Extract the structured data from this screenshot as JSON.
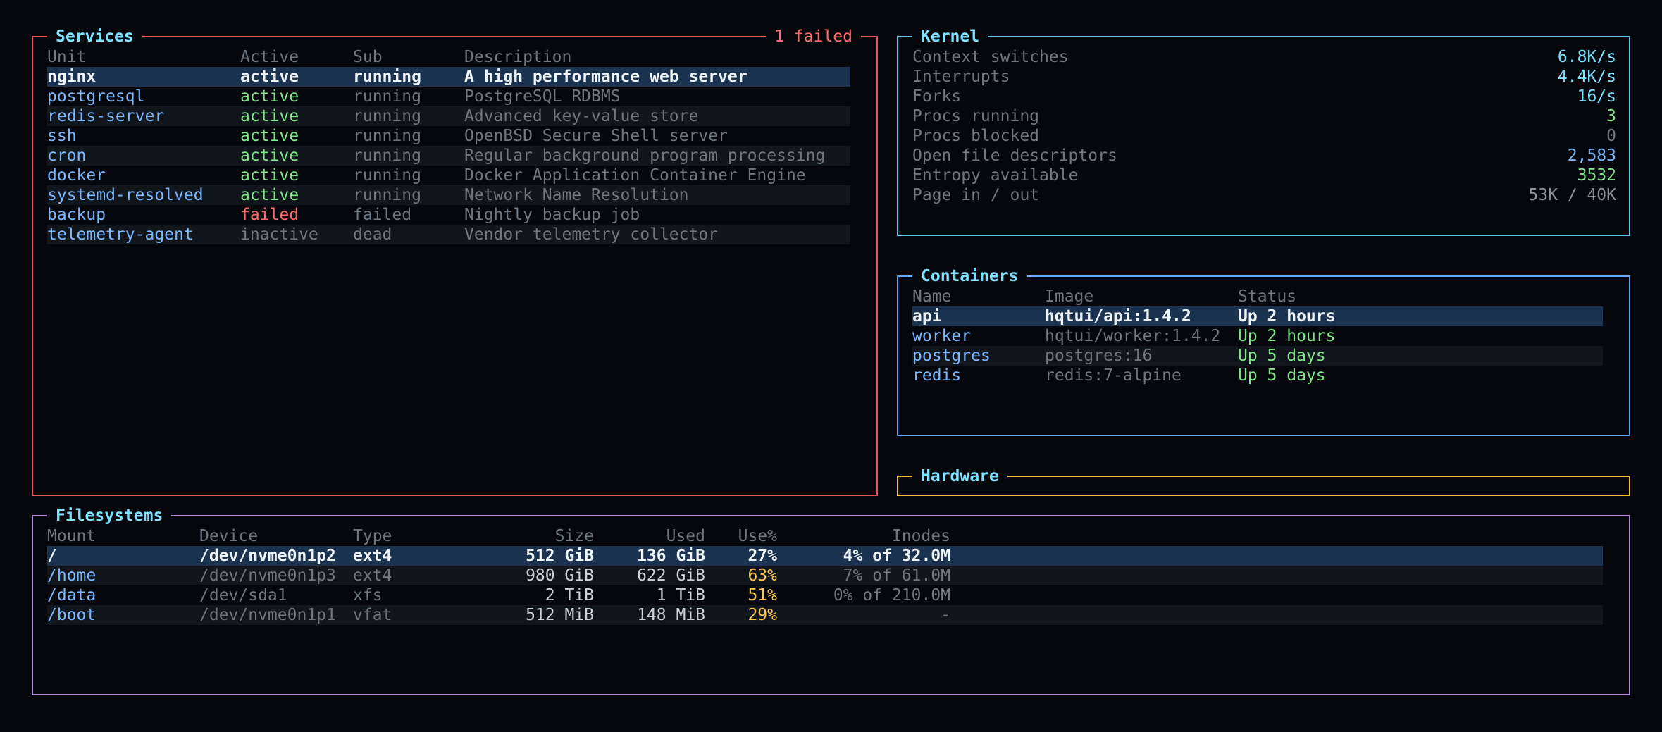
{
  "colors": {
    "background": "#05070c",
    "services_border": "#e8555a",
    "kernel_border": "#5ec8e6",
    "containers_border": "#5aa9ff",
    "hardware_border": "#f2c230",
    "filesystems_border": "#b48ce0",
    "selected_row": "#1b3350",
    "active_green": "#7ee787",
    "failed_red": "#ff6b6b",
    "name_blue": "#79b8ff",
    "usage_yellow": "#f9c74f",
    "title_cyan": "#7ee2ff"
  },
  "services": {
    "title": "Services",
    "badge": "1 failed",
    "columns": [
      "Unit",
      "Active",
      "Sub",
      "Description"
    ],
    "rows": [
      {
        "unit": "nginx",
        "active": "active",
        "sub": "running",
        "description": "A high performance web server",
        "state": "ok"
      },
      {
        "unit": "postgresql",
        "active": "active",
        "sub": "running",
        "description": "PostgreSQL RDBMS",
        "state": "ok"
      },
      {
        "unit": "redis-server",
        "active": "active",
        "sub": "running",
        "description": "Advanced key-value store",
        "state": "ok"
      },
      {
        "unit": "ssh",
        "active": "active",
        "sub": "running",
        "description": "OpenBSD Secure Shell server",
        "state": "ok"
      },
      {
        "unit": "cron",
        "active": "active",
        "sub": "running",
        "description": "Regular background program processing",
        "state": "ok"
      },
      {
        "unit": "docker",
        "active": "active",
        "sub": "running",
        "description": "Docker Application Container Engine",
        "state": "ok"
      },
      {
        "unit": "systemd-resolved",
        "active": "active",
        "sub": "running",
        "description": "Network Name Resolution",
        "state": "ok"
      },
      {
        "unit": "backup",
        "active": "failed",
        "sub": "failed",
        "description": "Nightly backup job",
        "state": "failed"
      },
      {
        "unit": "telemetry-agent",
        "active": "inactive",
        "sub": "dead",
        "description": "Vendor telemetry collector",
        "state": "inactive"
      }
    ]
  },
  "kernel": {
    "title": "Kernel",
    "rows": [
      {
        "label": "Context switches",
        "value": "6.8K/s",
        "color": "#7ee2ff"
      },
      {
        "label": "Interrupts",
        "value": "4.4K/s",
        "color": "#7ee2ff"
      },
      {
        "label": "Forks",
        "value": "16/s",
        "color": "#7ee2ff"
      },
      {
        "label": "Procs running",
        "value": "3",
        "color": "#7ee787"
      },
      {
        "label": "Procs blocked",
        "value": "0",
        "color": "#6e7681"
      },
      {
        "label": "Open file descriptors",
        "value": "2,583",
        "color": "#79b8ff"
      },
      {
        "label": "Entropy available",
        "value": "3532",
        "color": "#7ee787"
      },
      {
        "label": "Page in / out",
        "value": "53K / 40K",
        "color": "#8b949e"
      }
    ]
  },
  "containers": {
    "title": "Containers",
    "columns": [
      "Name",
      "Image",
      "Status"
    ],
    "rows": [
      {
        "name": "api",
        "image": "hqtui/api:1.4.2",
        "status": "Up 2 hours"
      },
      {
        "name": "worker",
        "image": "hqtui/worker:1.4.2",
        "status": "Up 2 hours"
      },
      {
        "name": "postgres",
        "image": "postgres:16",
        "status": "Up 5 days"
      },
      {
        "name": "redis",
        "image": "redis:7-alpine",
        "status": "Up 5 days"
      }
    ]
  },
  "hardware": {
    "title": "Hardware"
  },
  "filesystems": {
    "title": "Filesystems",
    "columns": [
      "Mount",
      "Device",
      "Type",
      "Size",
      "Used",
      "Use%",
      "Inodes"
    ],
    "rows": [
      {
        "mount": "/",
        "device": "/dev/nvme0n1p2",
        "type": "ext4",
        "size": "512 GiB",
        "used": "136 GiB",
        "use_pct": "27%",
        "inodes": "4% of 32.0M"
      },
      {
        "mount": "/home",
        "device": "/dev/nvme0n1p3",
        "type": "ext4",
        "size": "980 GiB",
        "used": "622 GiB",
        "use_pct": "63%",
        "inodes": "7% of 61.0M"
      },
      {
        "mount": "/data",
        "device": "/dev/sda1",
        "type": "xfs",
        "size": "2 TiB",
        "used": "1 TiB",
        "use_pct": "51%",
        "inodes": "0% of 210.0M"
      },
      {
        "mount": "/boot",
        "device": "/dev/nvme0n1p1",
        "type": "vfat",
        "size": "512 MiB",
        "used": "148 MiB",
        "use_pct": "29%",
        "inodes": "-"
      }
    ]
  }
}
